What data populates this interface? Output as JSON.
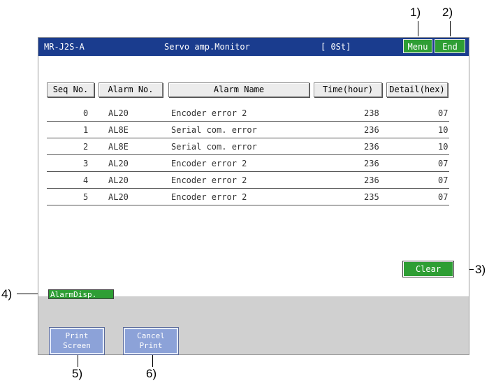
{
  "callouts": {
    "c1": "1)",
    "c2": "2)",
    "c3": "3)",
    "c4": "4)",
    "c5": "5)",
    "c6": "6)"
  },
  "titlebar": {
    "model": "MR-J2S-A",
    "title": "Servo amp.Monitor",
    "station": "[ 0St]",
    "menu_label": "Menu",
    "end_label": "End"
  },
  "table": {
    "headers": [
      "Seq No.",
      "Alarm No.",
      "Alarm Name",
      "Time(hour)",
      "Detail(hex)"
    ],
    "rows": [
      {
        "seq": "0",
        "alarm_no": "AL20",
        "name": "Encoder error 2",
        "time": "238",
        "detail": "07"
      },
      {
        "seq": "1",
        "alarm_no": "AL8E",
        "name": "Serial com. error",
        "time": "236",
        "detail": "10"
      },
      {
        "seq": "2",
        "alarm_no": "AL8E",
        "name": "Serial com. error",
        "time": "236",
        "detail": "10"
      },
      {
        "seq": "3",
        "alarm_no": "AL20",
        "name": "Encoder error 2",
        "time": "236",
        "detail": "07"
      },
      {
        "seq": "4",
        "alarm_no": "AL20",
        "name": "Encoder error 2",
        "time": "236",
        "detail": "07"
      },
      {
        "seq": "5",
        "alarm_no": "AL20",
        "name": "Encoder error 2",
        "time": "235",
        "detail": "07"
      }
    ]
  },
  "buttons": {
    "clear_label": "Clear",
    "alarm_disp_label": "AlarmDisp.",
    "print_screen_line1": "Print",
    "print_screen_line2": "Screen",
    "cancel_print_line1": "Cancel",
    "cancel_print_line2": "Print"
  },
  "colors": {
    "titlebar": "#1a3c8e",
    "green_button": "#2e9e34",
    "blue_button": "#8ca2d8",
    "frame": "#d0d0d0"
  }
}
